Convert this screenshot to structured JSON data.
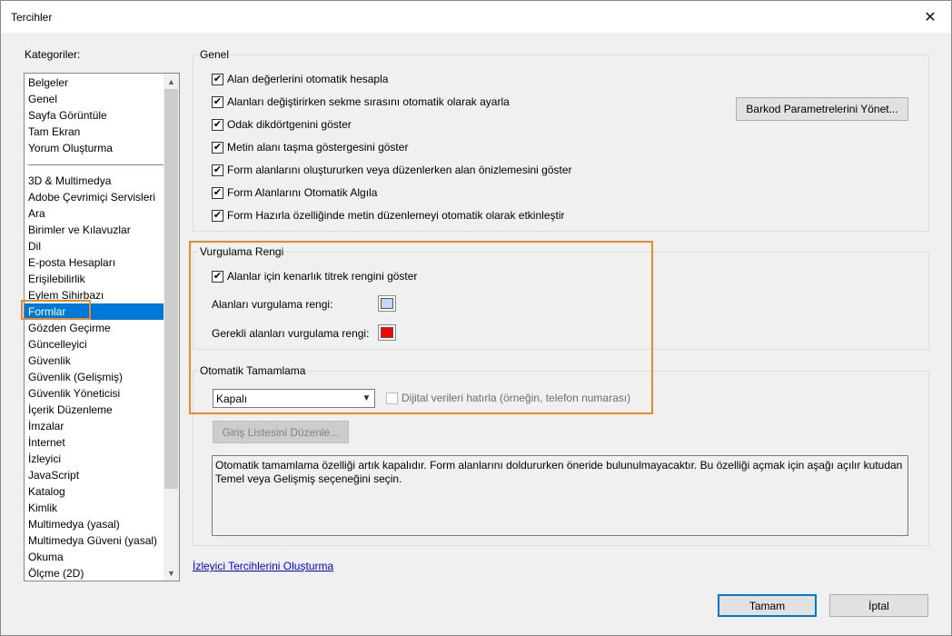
{
  "window": {
    "title": "Tercihler"
  },
  "categories": {
    "label": "Kategoriler:",
    "group1": [
      "Belgeler",
      "Genel",
      "Sayfa Görüntüle",
      "Tam Ekran",
      "Yorum Oluşturma"
    ],
    "group2": [
      "3D & Multimedya",
      "Adobe Çevrimiçi Servisleri",
      "Ara",
      "Birimler ve Kılavuzlar",
      "Dil",
      "E-posta Hesapları",
      "Erişilebilirlik",
      "Eylem Sihirbazı",
      "Formlar",
      "Gözden Geçirme",
      "Güncelleyici",
      "Güvenlik",
      "Güvenlik (Gelişmiş)",
      "Güvenlik Yöneticisi",
      "İçerik Düzenleme",
      "İmzalar",
      "İnternet",
      "İzleyici",
      "JavaScript",
      "Katalog",
      "Kimlik",
      "Multimedya (yasal)",
      "Multimedya Güveni (yasal)",
      "Okuma",
      "Ölçme (2D)"
    ],
    "selected": "Formlar"
  },
  "genel": {
    "title": "Genel",
    "checkboxes": [
      {
        "label": "Alan değerlerini otomatik hesapla",
        "checked": true
      },
      {
        "label": "Alanları değiştirirken sekme sırasını otomatik olarak ayarla",
        "checked": true
      },
      {
        "label": "Odak dikdörtgenini göster",
        "checked": true
      },
      {
        "label": "Metin alanı taşma göstergesini göster",
        "checked": true
      },
      {
        "label": "Form alanlarını oluştururken veya düzenlerken alan önizlemesini göster",
        "checked": true
      },
      {
        "label": "Form Alanlarını Otomatik Algıla",
        "checked": true
      },
      {
        "label": "Form Hazırla özelliğinde metin düzenlemeyi otomatik olarak etkinleştir",
        "checked": true
      }
    ],
    "barcode_button": "Barkod Parametrelerini Yönet..."
  },
  "vurgulama": {
    "title": "Vurgulama Rengi",
    "checkbox": {
      "label": "Alanlar için kenarlık titrek rengini göster",
      "checked": true
    },
    "field_color_label": "Alanları vurgulama rengi:",
    "field_color": "#c8d4f5",
    "required_color_label": "Gerekli alanları vurgulama rengi:",
    "required_color": "#ff0000"
  },
  "otomatik": {
    "title": "Otomatik Tamamlama",
    "select_value": "Kapalı",
    "digital_checkbox": {
      "label": "Dijital verileri hatırla (örneğin, telefon numarası)",
      "checked": false
    },
    "edit_list_button": "Giriş Listesini Düzenle...",
    "description": "Otomatik tamamlama özelliği artık kapalıdır. Form alanlarını doldururken öneride bulunulmayacaktır. Bu özelliği açmak için aşağı açılır kutudan Temel veya Gelişmiş seçeneğini seçin."
  },
  "footer": {
    "link": "İzleyici Tercihlerini Oluşturma",
    "ok": "Tamam",
    "cancel": "İptal"
  },
  "colors": {
    "highlight": "#e8892b",
    "selection": "#0078d7"
  }
}
